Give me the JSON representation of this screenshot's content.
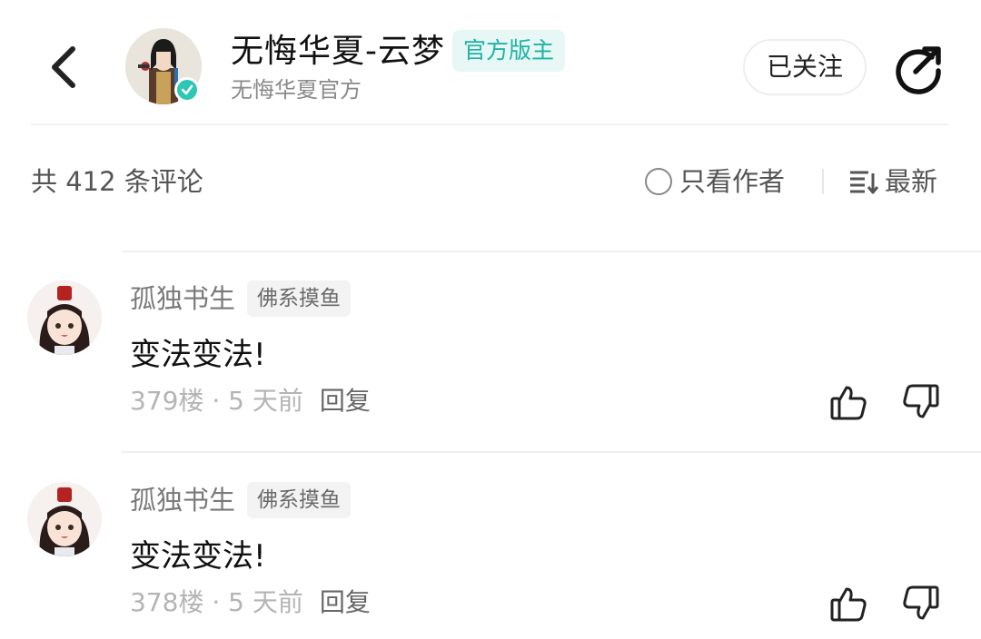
{
  "header": {
    "author_name": "无悔华夏-云梦",
    "badge": "官方版主",
    "subtitle": "无悔华夏官方",
    "follow_label": "已关注",
    "icons": {
      "back": "chevron-left-icon",
      "share": "share-icon",
      "verified": "verified-check-icon"
    }
  },
  "comment_bar": {
    "count_label": "共 412 条评论",
    "author_only_label": "只看作者",
    "sort_label": "最新"
  },
  "comments": [
    {
      "user": "孤独书生",
      "tag": "佛系摸鱼",
      "text": "变法变法!",
      "floor_time": "379楼 · 5 天前",
      "reply_label": "回复"
    },
    {
      "user": "孤独书生",
      "tag": "佛系摸鱼",
      "text": "变法变法!",
      "floor_time": "378楼 · 5 天前",
      "reply_label": "回复"
    }
  ],
  "colors": {
    "accent": "#1fb3a3",
    "badge_bg": "#e6f7f5",
    "muted": "#b4b4b4"
  }
}
